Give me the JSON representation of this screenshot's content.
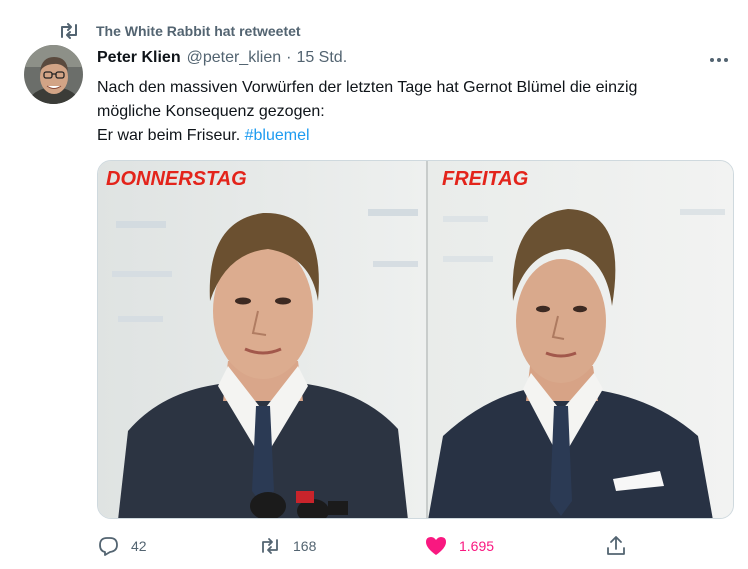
{
  "retweet": {
    "text": "The White Rabbit hat retweetet",
    "icon": "retweet-icon"
  },
  "author": {
    "name": "Peter Klien",
    "handle": "@peter_klien",
    "separator": "·",
    "time": "15 Std."
  },
  "more_icon": "more-options-icon",
  "tweet": {
    "line1": "Nach den massiven Vorwürfen der letzten Tage hat Gernot Blümel die einzig",
    "line2": "mögliche Konsequenz gezogen:",
    "line3": "Er war beim Friseur.",
    "hashtag": "#bluemel"
  },
  "media": {
    "left_label": "DONNERSTAG",
    "right_label": "FREITAG",
    "label_color": "#e3241b"
  },
  "actions": {
    "reply": {
      "count": "42",
      "icon": "reply-icon"
    },
    "retweet": {
      "count": "168",
      "icon": "retweet-icon"
    },
    "like": {
      "count": "1.695",
      "icon": "heart-filled-icon",
      "color": "#f91880"
    },
    "share": {
      "icon": "share-icon"
    }
  },
  "colors": {
    "secondary": "#536471",
    "link": "#1d9bf0",
    "text": "#0f1419"
  }
}
